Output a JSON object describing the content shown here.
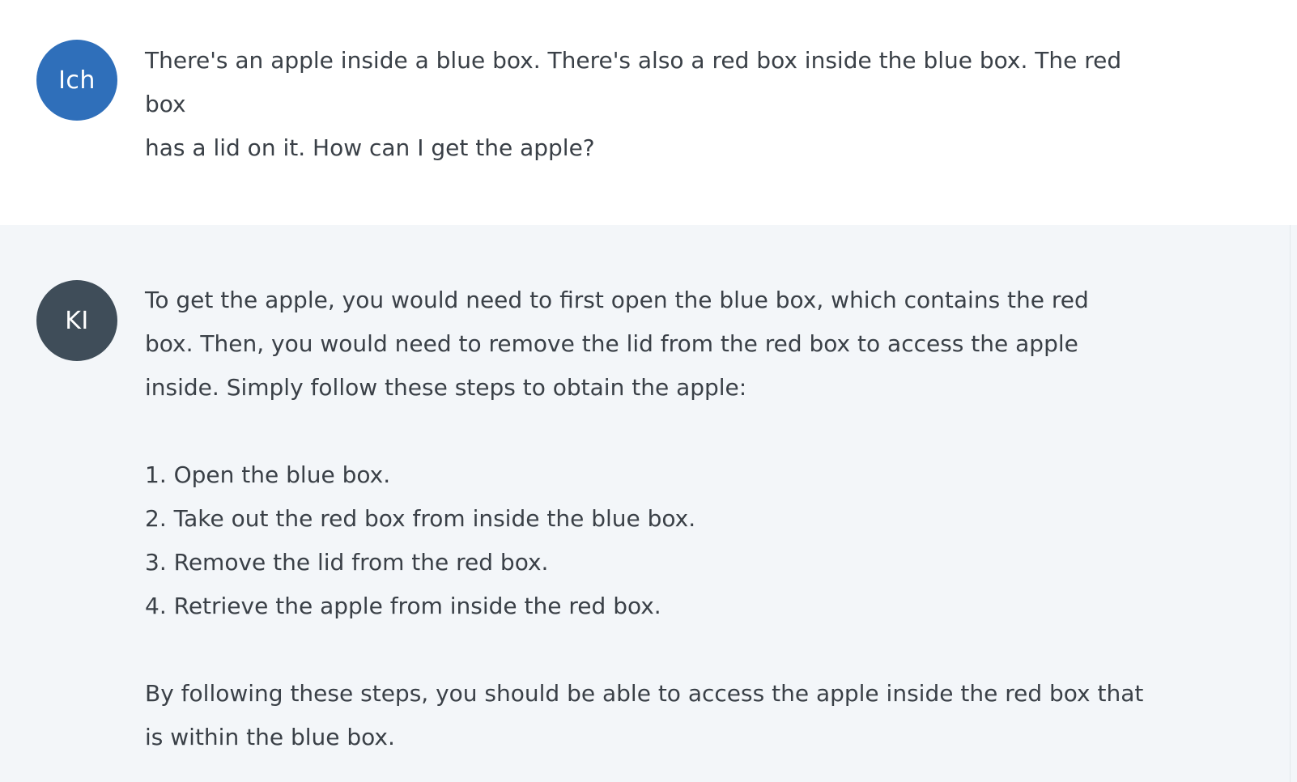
{
  "messages": {
    "user": {
      "avatar_label": "Ich",
      "lines": [
        "There's an apple inside a blue box. There's also a red box inside the blue box. The red",
        "box",
        "has a lid on it. How can I get the apple?"
      ]
    },
    "ai": {
      "avatar_label": "KI",
      "intro_lines": [
        "To get the apple, you would need to first open the blue box, which contains the red",
        "box. Then, you would need to remove the lid from the red box to access the apple",
        "inside. Simply follow these steps to obtain the apple:"
      ],
      "steps": [
        "1. Open the blue box.",
        "2. Take out the red box from inside the blue box.",
        "3. Remove the lid from the red box.",
        "4. Retrieve the apple from inside the red box."
      ],
      "outro_lines": [
        "By following these steps, you should be able to access the apple inside the red box that",
        "is within the blue box."
      ]
    }
  },
  "colors": {
    "user_avatar": "#2f6fba",
    "ai_avatar": "#3f4d59",
    "ai_background": "#f3f6f9",
    "text": "#3a4047"
  }
}
